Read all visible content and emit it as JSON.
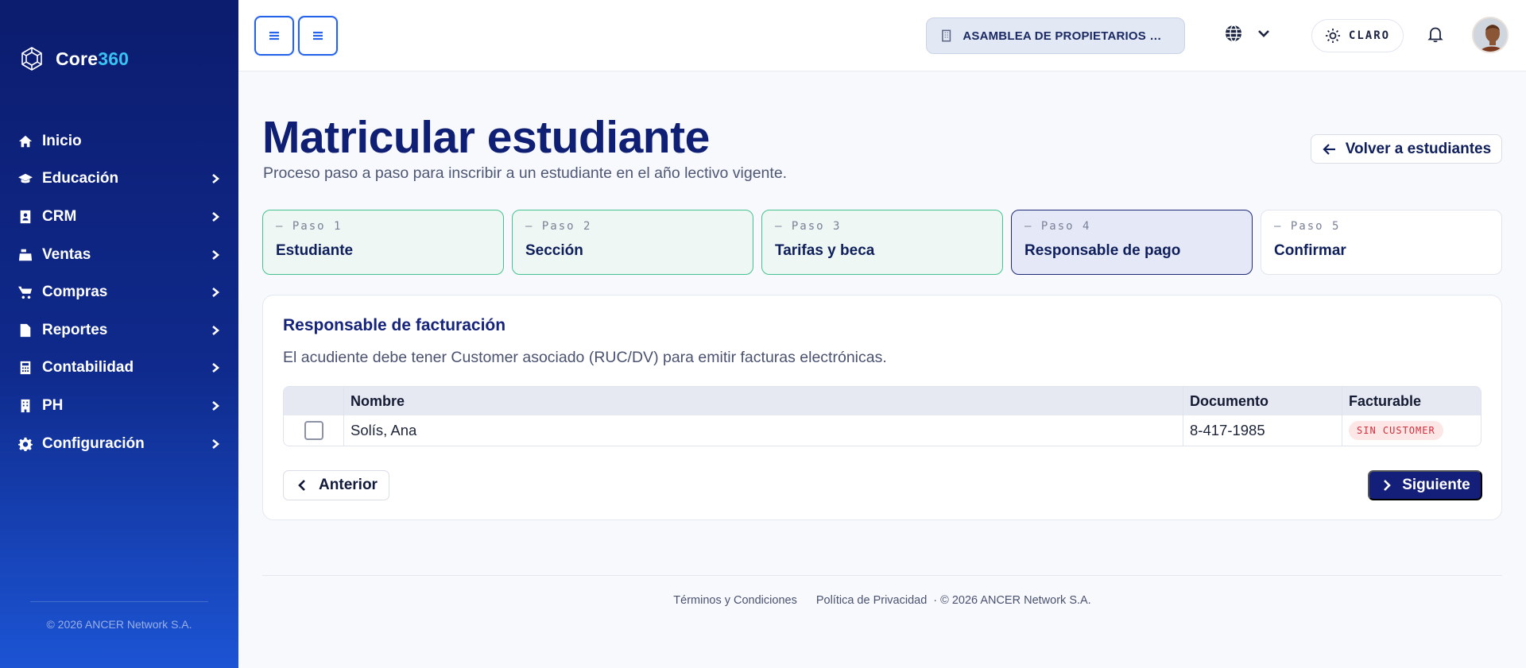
{
  "brand": {
    "prefix": "Core",
    "accent": "360"
  },
  "sidebar": {
    "items": [
      {
        "label": "Inicio",
        "icon": "home-icon",
        "has_children": false
      },
      {
        "label": "Educación",
        "icon": "graduation-cap-icon",
        "has_children": true
      },
      {
        "label": "CRM",
        "icon": "contact-card-icon",
        "has_children": true
      },
      {
        "label": "Ventas",
        "icon": "cash-register-icon",
        "has_children": true
      },
      {
        "label": "Compras",
        "icon": "cart-icon",
        "has_children": true
      },
      {
        "label": "Reportes",
        "icon": "document-icon",
        "has_children": true
      },
      {
        "label": "Contabilidad",
        "icon": "calculator-icon",
        "has_children": true
      },
      {
        "label": "PH",
        "icon": "building-icon",
        "has_children": true
      },
      {
        "label": "Configuración",
        "icon": "gear-icon",
        "has_children": true
      }
    ],
    "footer": "© 2026 ANCER Network S.A."
  },
  "topbar": {
    "organization": "ASAMBLEA DE PROPIETARIOS DE ...",
    "theme_label": "CLARO"
  },
  "page": {
    "title": "Matricular estudiante",
    "subtitle": "Proceso paso a paso para inscribir a un estudiante en el año lectivo vigente.",
    "back_label": "Volver a estudiantes"
  },
  "steps": [
    {
      "number": "— Paso 1",
      "name": "Estudiante",
      "state": "done"
    },
    {
      "number": "— Paso 2",
      "name": "Sección",
      "state": "done"
    },
    {
      "number": "— Paso 3",
      "name": "Tarifas y beca",
      "state": "done"
    },
    {
      "number": "— Paso 4",
      "name": "Responsable de pago",
      "state": "current"
    },
    {
      "number": "— Paso 5",
      "name": "Confirmar",
      "state": "pending"
    }
  ],
  "billing": {
    "title": "Responsable de facturación",
    "description": "El acudiente debe tener Customer asociado (RUC/DV) para emitir facturas electrónicas.",
    "columns": {
      "name": "Nombre",
      "document": "Documento",
      "billable": "Facturable"
    },
    "rows": [
      {
        "name": "Solís, Ana",
        "document": "8-417-1985",
        "billable": "SIN CUSTOMER",
        "selected": false
      }
    ],
    "prev_label": "Anterior",
    "next_label": "Siguiente"
  },
  "footer": {
    "terms": "Términos y Condiciones",
    "privacy": "Política de Privacidad",
    "copyright": "· © 2026 ANCER Network S.A."
  },
  "colors": {
    "primary": "#131f78",
    "accent": "#2563eb",
    "brand_accent": "#39c2f2",
    "step_done": "#45c28f",
    "badge_danger": "#d0303c"
  }
}
